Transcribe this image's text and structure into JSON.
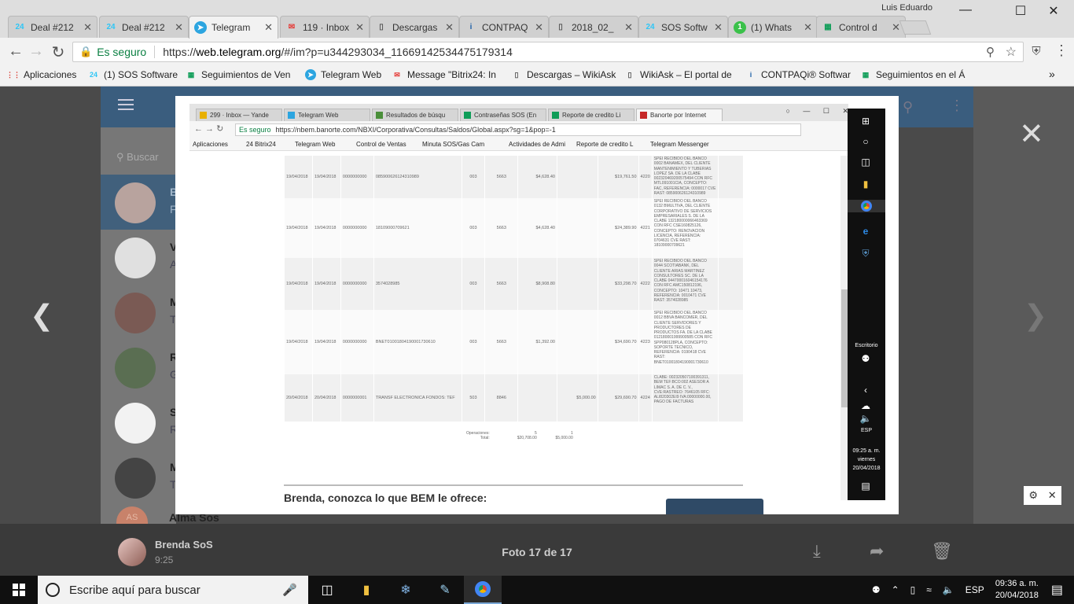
{
  "chrome": {
    "user_name": "Luis Eduardo",
    "tabs": [
      {
        "label": "Deal #212",
        "icon": "bitrix24-icon",
        "active": false
      },
      {
        "label": "Deal #212",
        "icon": "bitrix24-icon",
        "active": false
      },
      {
        "label": "Telegram",
        "icon": "telegram-icon",
        "active": true
      },
      {
        "label": "119 · Inbox",
        "icon": "yandex-mail-icon",
        "active": false
      },
      {
        "label": "Descargas",
        "icon": "page-icon",
        "active": false
      },
      {
        "label": "CONTPAQ",
        "icon": "contpaqi-icon",
        "active": false
      },
      {
        "label": "2018_02_",
        "icon": "page-icon",
        "active": false
      },
      {
        "label": "SOS Softw",
        "icon": "bitrix24-icon",
        "active": false
      },
      {
        "label": "(1) Whats",
        "icon": "whatsapp-icon",
        "active": false
      },
      {
        "label": "Control d",
        "icon": "sheets-icon",
        "active": false
      }
    ],
    "secure_label": "Es seguro",
    "url_scheme": "https://",
    "url_host": "web.telegram.org",
    "url_rest": "/#/im?p=u344293034_11669142534475179314",
    "bookmarks": [
      {
        "label": "Aplicaciones",
        "icon": "apps-grid-icon"
      },
      {
        "label": "(1) SOS Software",
        "icon": "bitrix24-icon"
      },
      {
        "label": "Seguimientos de Ven",
        "icon": "sheets-icon"
      },
      {
        "label": "Telegram Web",
        "icon": "telegram-icon"
      },
      {
        "label": "Message \"Bitrix24: In",
        "icon": "yandex-mail-icon"
      },
      {
        "label": "Descargas – WikiAsk",
        "icon": "page-icon"
      },
      {
        "label": "WikiAsk – El portal de",
        "icon": "page-icon"
      },
      {
        "label": "CONTPAQi® Softwar",
        "icon": "contpaqi-icon"
      },
      {
        "label": "Seguimientos en el Á",
        "icon": "sheets-icon"
      }
    ],
    "bookmarks_more": "»"
  },
  "telegram": {
    "search_placeholder": "Buscar",
    "chat_letters": [
      {
        "l1": "B",
        "l2": "F"
      },
      {
        "l1": "V",
        "l2": "A"
      },
      {
        "l1": "M",
        "l2": "T"
      },
      {
        "l1": "R",
        "l2": "G"
      },
      {
        "l1": "S",
        "l2": "R"
      },
      {
        "l1": "M",
        "l2": "T"
      }
    ],
    "last_chat_name": "Alma Sos",
    "last_chat_initials": "AS"
  },
  "viewer": {
    "sender": "Brenda SoS",
    "time": "9:25",
    "counter": "Foto 17 de 17"
  },
  "photo": {
    "inner_tabs": [
      {
        "label": "299 · Inbox — Yande",
        "color": "#e8b000"
      },
      {
        "label": "Telegram Web",
        "color": "#2ca5e0"
      },
      {
        "label": "Resultados de búsqu",
        "color": "#4a8f3a"
      },
      {
        "label": "Contraseñas SOS (En",
        "color": "#0f9d58"
      },
      {
        "label": "Reporte de credito Li",
        "color": "#0f9d58"
      },
      {
        "label": "Banorte por Internet",
        "color": "#c62828"
      }
    ],
    "inner_secure": "Es seguro",
    "inner_url": "https://nbem.banorte.com/NBXI/Corporativa/Consultas/Saldos/Global.aspx?sg=1&pop=-1",
    "inner_bookmarks": [
      "Aplicaciones",
      "24 Bitrix24",
      "Telegram Web",
      "Control de Ventas",
      "Minuta SOS/Gas Cam",
      "Actividades de Admi",
      "Reporte de credito L",
      "Telegram Messenger"
    ],
    "rows": [
      {
        "f1": "19/04/2018",
        "f2": "19/04/2018",
        "ref": "0000000000",
        "num": "085900626124310989",
        "c1": "003",
        "c2": "5663",
        "amt": "$4,628.40",
        "dep": "",
        "bal": "$19,761.50",
        "cd": "4220",
        "desc": "SPEI RECIBIDO DEL BANCO 0002 BANAMEX, DEL CLIENTE MANTENIMIENTO Y TUBERIAS LOPEZ SA. DE LA CLABE 002320469200575494 CON RFC MTL091001CIA, CONCEPTO: FAC, REFERENCIA: 0000017 CVE RAST: 085900626124310989"
      },
      {
        "f1": "19/04/2018",
        "f2": "19/04/2018",
        "ref": "0000000000",
        "num": "18109000709621",
        "c1": "003",
        "c2": "5663",
        "amt": "$4,628.40",
        "dep": "",
        "bal": "$24,389.90",
        "cd": "4221",
        "desc": "SPEI RECIBIDO DEL BANCO 0132 BMULTIVA, DEL CLIENTE CORPORATIVO DE SERVICIOS EMPRESARIALES S. DE LA CLABE 132180000066463369 CON RFC CSE160825126, CONCEPTO: RENOVACION LICENCIA, REFERENCIA: 0704631 CVE RAST: 18109000709621"
      },
      {
        "f1": "19/04/2018",
        "f2": "19/04/2018",
        "ref": "0000000000",
        "num": "3574028985",
        "c1": "003",
        "c2": "5663",
        "amt": "$8,908.80",
        "dep": "",
        "bal": "$33,298.70",
        "cd": "4222",
        "desc": "SPEI RECIBIDO DEL BANCO 0044 SCOTIABANK, DEL CLIENTE ARIAS MARTINEZ CONSULTORES SC. DE LA CLABE 044700016046154176 CON RFC AMC150812196, CONCEPTO: 10471 10473, REFERENCIA: 0010471 CVE RAST: 3574028985"
      },
      {
        "f1": "19/04/2018",
        "f2": "19/04/2018",
        "ref": "0000000000",
        "num": "BNET01001804190001730610",
        "c1": "003",
        "c2": "5663",
        "amt": "$1,392.00",
        "dep": "",
        "bal": "$34,690.70",
        "cd": "4223",
        "desc": "SPEI RECIBIDO DEL BANCO 0012 BBVA BANCOMER, DEL CLIENTE SERVIDORES Y PRODUCTORES DE PRODUCTOS FA. DE LA CLABE 012180001999900585 CON RFC SPP080128PLA, CONCEPTO: SOPORTE TECNICO, REFERENCIA: 0190418 CVE RAST: BNET01001804190001730610"
      },
      {
        "f1": "20/04/2018",
        "f2": "20/04/2018",
        "ref": "0000000001",
        "num": "TRANSF ELECTRONICA FONDOS: TEF",
        "c1": "503",
        "c2": "8846",
        "amt": "",
        "dep": "$5,000.00",
        "bal": "$29,690.70",
        "cd": "4224",
        "desc": "CLABE: 002320507100391311, BEM TEF:BCO:002 Asesor a Limac S. A. de C. V., CVE:RASTREO: 7646105 RFC: ALI820302EI9 IVA:00000000.00, PAGO DE FACTURAS"
      }
    ],
    "totals_ops_label": "Operaciones:",
    "totals_total_label": "Total:",
    "totals_ops_debit": "5",
    "totals_ops_credit": "1",
    "totals_debit": "$20,708.00",
    "totals_credit": "$5,000.00",
    "promo": "Brenda, conozca lo que BEM le ofrece:",
    "inner_taskbar_label": "Escritorio",
    "inner_lang": "ESP",
    "inner_time": "09:25 a. m.",
    "inner_day": "viernes",
    "inner_date": "20/04/2018"
  },
  "taskbar": {
    "search_placeholder": "Escribe aquí para buscar",
    "lang": "ESP",
    "time": "09:36 a. m.",
    "date": "20/04/2018"
  }
}
